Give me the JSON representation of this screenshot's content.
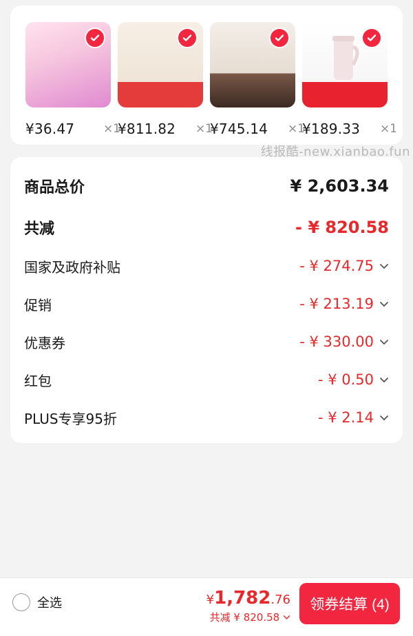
{
  "products": [
    {
      "price": "¥36.47",
      "qty": "×1"
    },
    {
      "price": "¥811.82",
      "qty": "×1"
    },
    {
      "price": "¥745.14",
      "qty": "×1"
    },
    {
      "price": "¥189.33",
      "qty": "×1"
    }
  ],
  "watermark": "线报酷-new.xianbao.fun",
  "summary": {
    "total_label": "商品总价",
    "total_value": "¥ 2,603.34",
    "discount_label": "共减",
    "discount_value": "- ¥ 820.58",
    "items": [
      {
        "label": "国家及政府补贴",
        "value": "- ¥ 274.75"
      },
      {
        "label": "促销",
        "value": "- ¥ 213.19"
      },
      {
        "label": "优惠券",
        "value": "- ¥ 330.00"
      },
      {
        "label": "红包",
        "value": "- ¥ 0.50"
      },
      {
        "label": "PLUS专享95折",
        "value": "- ¥ 2.14"
      }
    ]
  },
  "bottom": {
    "select_all": "全选",
    "pay_yen": "¥",
    "pay_int": "1,782",
    "pay_dec": ".76",
    "saved": "共减 ¥ 820.58",
    "checkout_label": "领券结算 (4)"
  },
  "colors": {
    "accent": "#f2263f",
    "discount": "#e8282b"
  }
}
